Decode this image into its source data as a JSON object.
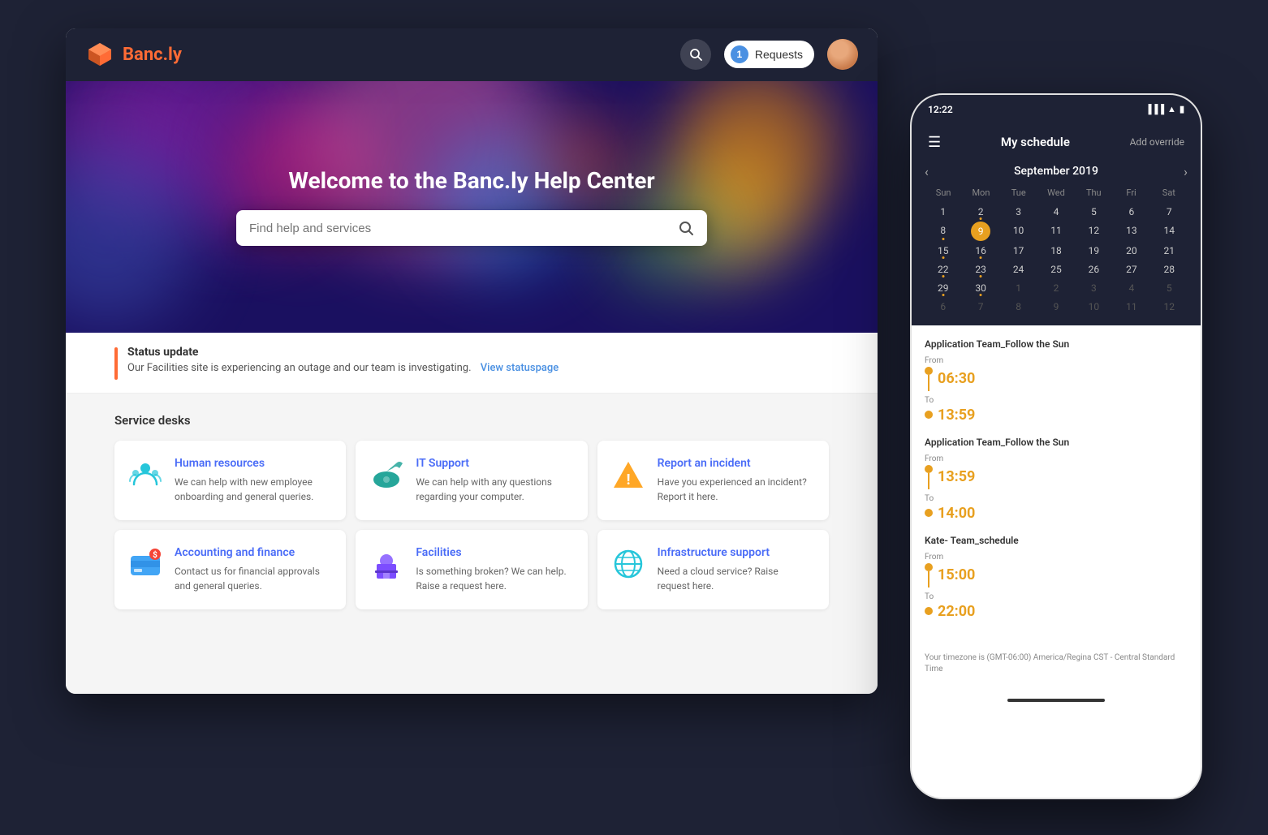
{
  "nav": {
    "logo_text_first": "Banc",
    "logo_text_second": ".ly",
    "requests_label": "Requests",
    "requests_count": "1"
  },
  "hero": {
    "title": "Welcome to the Banc.ly Help Center",
    "search_placeholder": "Find help and services"
  },
  "status": {
    "title": "Status update",
    "message": "Our Facilities site is experiencing an outage and our team is investigating.",
    "link_text": "View statuspage"
  },
  "service_desks": {
    "section_title": "Service desks",
    "cards": [
      {
        "title": "Human resources",
        "description": "We can help with new employee onboarding and general queries.",
        "icon": "hr"
      },
      {
        "title": "IT Support",
        "description": "We can help with any questions regarding your computer.",
        "icon": "it"
      },
      {
        "title": "Report an incident",
        "description": "Have you experienced an incident? Report it here.",
        "icon": "incident"
      },
      {
        "title": "Accounting and finance",
        "description": "Contact us for financial approvals and general queries.",
        "icon": "accounting"
      },
      {
        "title": "Facilities",
        "description": "Is something broken? We can help. Raise a request here.",
        "icon": "facilities"
      },
      {
        "title": "Infrastructure support",
        "description": "Need a cloud service? Raise request here.",
        "icon": "infrastructure"
      }
    ]
  },
  "phone": {
    "time": "12:22",
    "header_title": "My schedule",
    "add_override": "Add override",
    "calendar": {
      "month": "September 2019",
      "weekdays": [
        "Sun",
        "Mon",
        "Tue",
        "Wed",
        "Thu",
        "Fri",
        "Sat"
      ],
      "weeks": [
        [
          "1",
          "2",
          "3",
          "4",
          "5",
          "6",
          "7"
        ],
        [
          "8",
          "9",
          "10",
          "11",
          "12",
          "13",
          "14"
        ],
        [
          "15",
          "16",
          "17",
          "18",
          "19",
          "20",
          "21"
        ],
        [
          "22",
          "23",
          "24",
          "25",
          "26",
          "27",
          "28"
        ],
        [
          "29",
          "30",
          "1",
          "2",
          "3",
          "4",
          "5"
        ],
        [
          "6",
          "7",
          "8",
          "9",
          "10",
          "11",
          "12"
        ]
      ],
      "today": "9",
      "dotted_days": [
        "2",
        "8",
        "9",
        "15",
        "16",
        "22",
        "23",
        "29",
        "30"
      ]
    },
    "schedules": [
      {
        "title": "Application Team_Follow the Sun",
        "from_label": "From",
        "from_time": "06:30",
        "to_label": "To",
        "to_time": "13:59"
      },
      {
        "title": "Application Team_Follow the Sun",
        "from_label": "From",
        "from_time": "13:59",
        "to_label": "To",
        "to_time": "14:00"
      },
      {
        "title": "Kate- Team_schedule",
        "from_label": "From",
        "from_time": "15:00",
        "to_label": "To",
        "to_time": "22:00"
      }
    ],
    "timezone": "Your timezone is (GMT-06:00) America/Regina CST - Central Standard Time"
  }
}
